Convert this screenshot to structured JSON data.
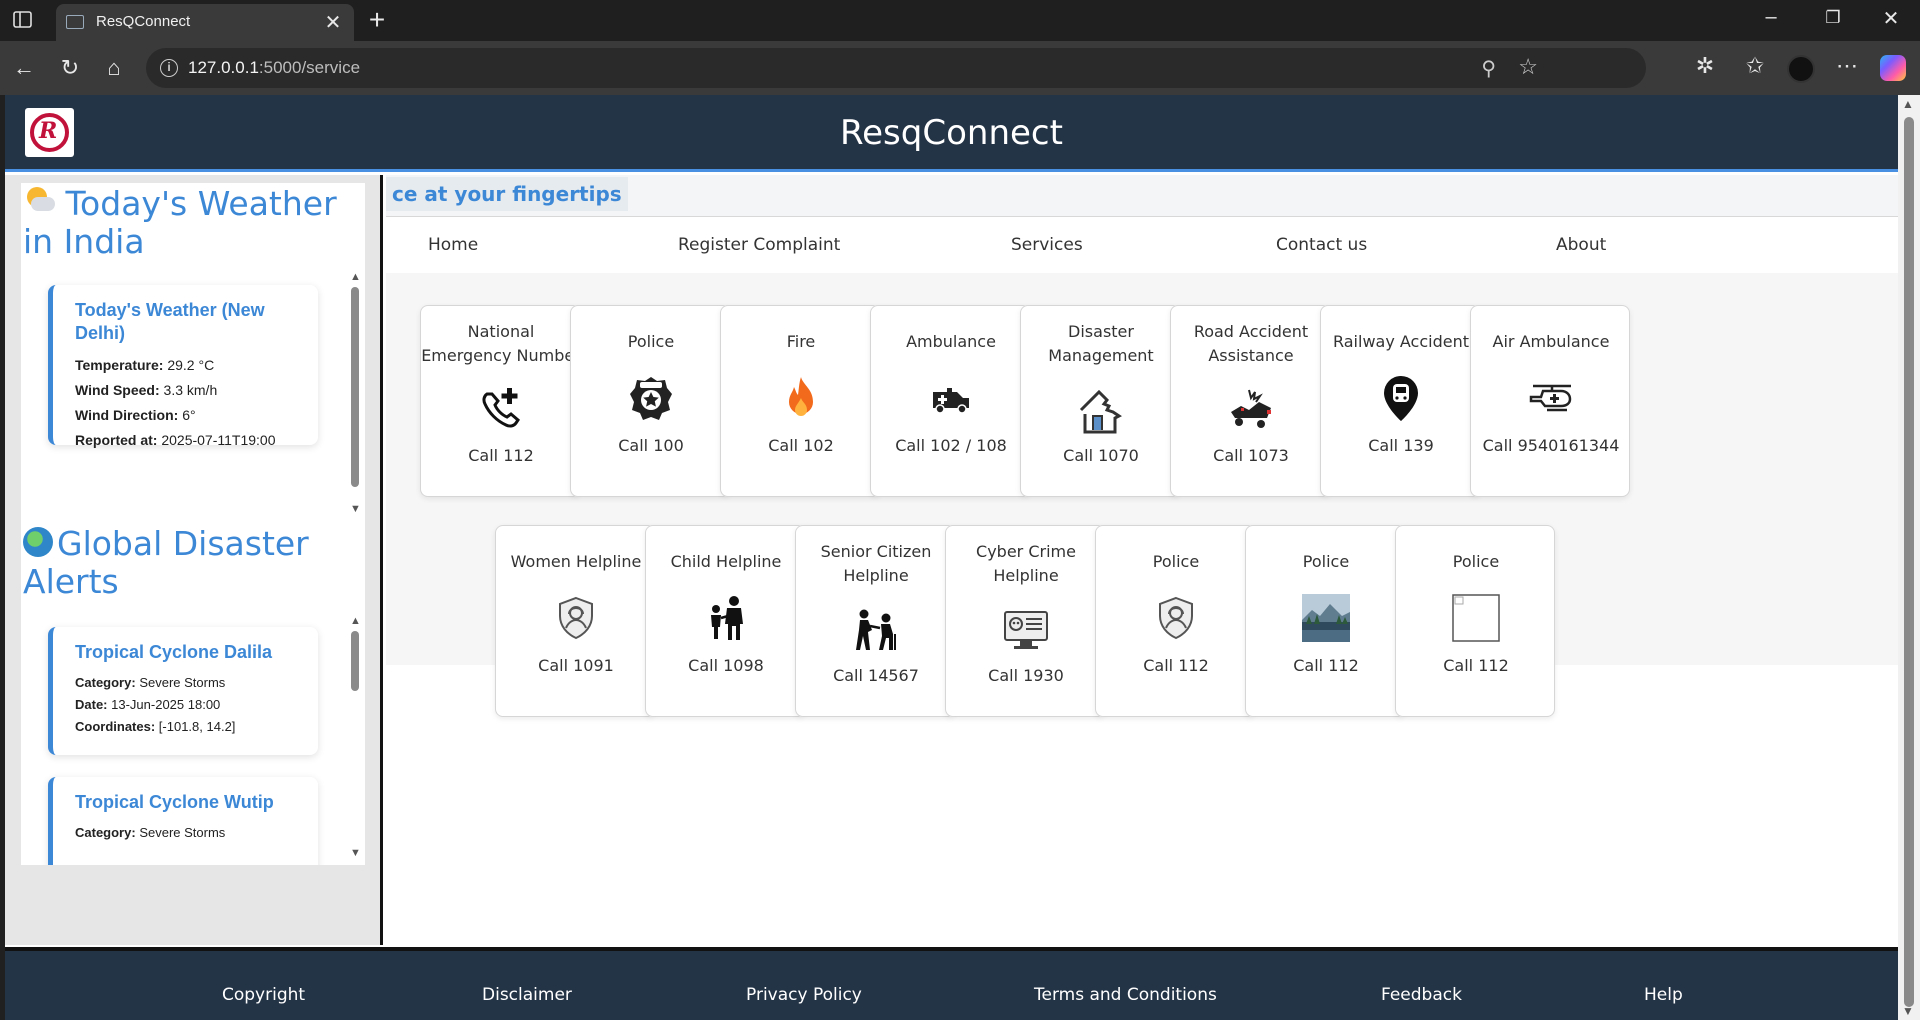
{
  "browser": {
    "tab_title": "ResQConnect",
    "url_host": "127.0.0.1",
    "url_rest": ":5000/service"
  },
  "site": {
    "title": "ResqConnect",
    "logo_letter": "R",
    "marquee": "ce at your fingertips"
  },
  "nav": [
    "Home",
    "Register Complaint",
    "Services",
    "Contact us",
    "About"
  ],
  "weather": {
    "heading": "Today's Weather in India",
    "card_title": "Today's Weather (New Delhi)",
    "rows": [
      {
        "label": "Temperature:",
        "value": "29.2 °C"
      },
      {
        "label": "Wind Speed:",
        "value": "3.3 km/h"
      },
      {
        "label": "Wind Direction:",
        "value": "6°"
      },
      {
        "label": "Reported at:",
        "value": "2025-07-11T19:00"
      }
    ]
  },
  "disasters": {
    "heading": "Global Disaster Alerts",
    "items": [
      {
        "title": "Tropical Cyclone Dalila",
        "rows": [
          {
            "label": "Category:",
            "value": "Severe Storms"
          },
          {
            "label": "Date:",
            "value": "13-Jun-2025 18:00"
          },
          {
            "label": "Coordinates:",
            "value": "[-101.8, 14.2]"
          }
        ]
      },
      {
        "title": "Tropical Cyclone Wutip",
        "rows": [
          {
            "label": "Category:",
            "value": "Severe Storms"
          }
        ]
      }
    ]
  },
  "services": [
    {
      "name": "National Emergency Number",
      "call": "Call 112",
      "icon": "phone-plus-icon"
    },
    {
      "name": "Police",
      "call": "Call 100",
      "icon": "police-badge-icon"
    },
    {
      "name": "Fire",
      "call": "Call 102",
      "icon": "fire-icon"
    },
    {
      "name": "Ambulance",
      "call": "Call 102 / 108",
      "icon": "ambulance-icon"
    },
    {
      "name": "Disaster Management",
      "call": "Call 1070",
      "icon": "damaged-house-icon"
    },
    {
      "name": "Road Accident Assistance",
      "call": "Call 1073",
      "icon": "road-accident-icon"
    },
    {
      "name": "Railway Accident",
      "call": "Call 139",
      "icon": "train-pin-icon"
    },
    {
      "name": "Air Ambulance",
      "call": "Call 9540161344",
      "icon": "helicopter-icon"
    },
    {
      "name": "Women Helpline",
      "call": "Call 1091",
      "icon": "woman-shield-icon"
    },
    {
      "name": "Child Helpline",
      "call": "Call 1098",
      "icon": "child-adult-icon"
    },
    {
      "name": "Senior Citizen Helpline",
      "call": "Call 14567",
      "icon": "senior-citizen-icon"
    },
    {
      "name": "Cyber Crime Helpline",
      "call": "Call 1930",
      "icon": "cyber-crime-icon"
    },
    {
      "name": "Police",
      "call": "Call 112",
      "icon": "woman-shield-icon"
    },
    {
      "name": "Police",
      "call": "Call 112",
      "icon": "landscape-photo-icon"
    },
    {
      "name": "Police",
      "call": "Call 112",
      "icon": "broken-image-icon"
    }
  ],
  "footer": [
    "Copyright",
    "Disclaimer",
    "Privacy Policy",
    "Terms and Conditions",
    "Feedback",
    "Help"
  ]
}
